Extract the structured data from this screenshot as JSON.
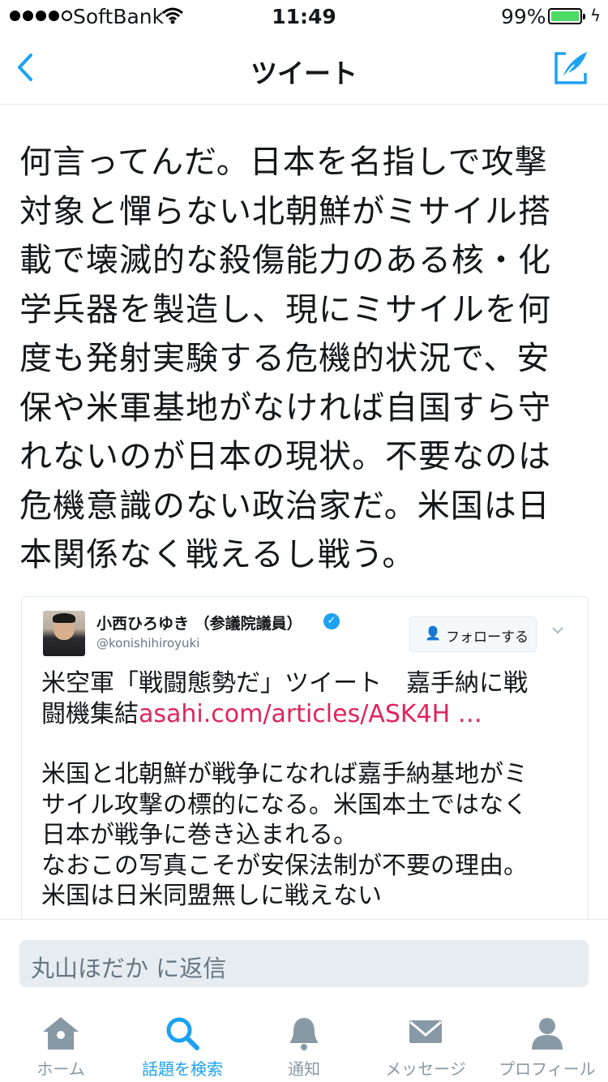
{
  "status_bar": {
    "carrier": "SoftBank",
    "time": "11:49",
    "battery_percent": "99%",
    "battery_level": 0.99,
    "signal_bars": 4,
    "signal_total": 5
  },
  "nav": {
    "title": "ツイート",
    "back_icon": "chevron-left-icon",
    "compose_icon": "compose-tweet-icon",
    "accent_color": "#1da1f2"
  },
  "tweet": {
    "lines": [
      "何言ってんだ。日本を名指しで攻撃",
      "対象と憚らない北朝鮮がミサイル搭",
      "載で壊滅的な殺傷能力のある核・化",
      "学兵器を製造し、現にミサイルを何",
      "度も発射実験する危機的状況で、安",
      "保や米軍基地がなければ自国すら守",
      "れないのが日本の現状。不要なのは",
      "危機意識のない政治家だ。米国は日",
      "本関係なく戦えるし戦う。"
    ]
  },
  "embedded_tweet": {
    "author_name": "小西ひろゆき （参議院議員）",
    "handle": "@konishihiroyuki",
    "verified_icon": "verified-badge-icon",
    "follow_label": "フォローする",
    "line1": "米空軍「戦闘態勢だ」ツイート　嘉手納に戦",
    "line2_text": "闘機集結",
    "line2_link": "asahi.com/articles/ASK4H …",
    "link_color": "#e0245e",
    "para_lines": [
      "米国と北朝鮮が戦争になれば嘉手納基地がミ",
      "サイル攻撃の標的になる。米国本土ではなく",
      "日本が戦争に巻き込まれる。",
      "なおこの写真こそが安保法制が不要の理由。",
      "米国は日米同盟無しに戦えない"
    ]
  },
  "reply": {
    "placeholder": "丸山ほだか に返信"
  },
  "tab_bar": {
    "items": [
      {
        "label": "ホーム",
        "icon": "home-icon",
        "active": false
      },
      {
        "label": "話題を検索",
        "icon": "search-icon",
        "active": true
      },
      {
        "label": "通知",
        "icon": "bell-icon",
        "active": false
      },
      {
        "label": "メッセージ",
        "icon": "envelope-icon",
        "active": false
      },
      {
        "label": "プロフィール",
        "icon": "person-icon",
        "active": false
      }
    ]
  }
}
